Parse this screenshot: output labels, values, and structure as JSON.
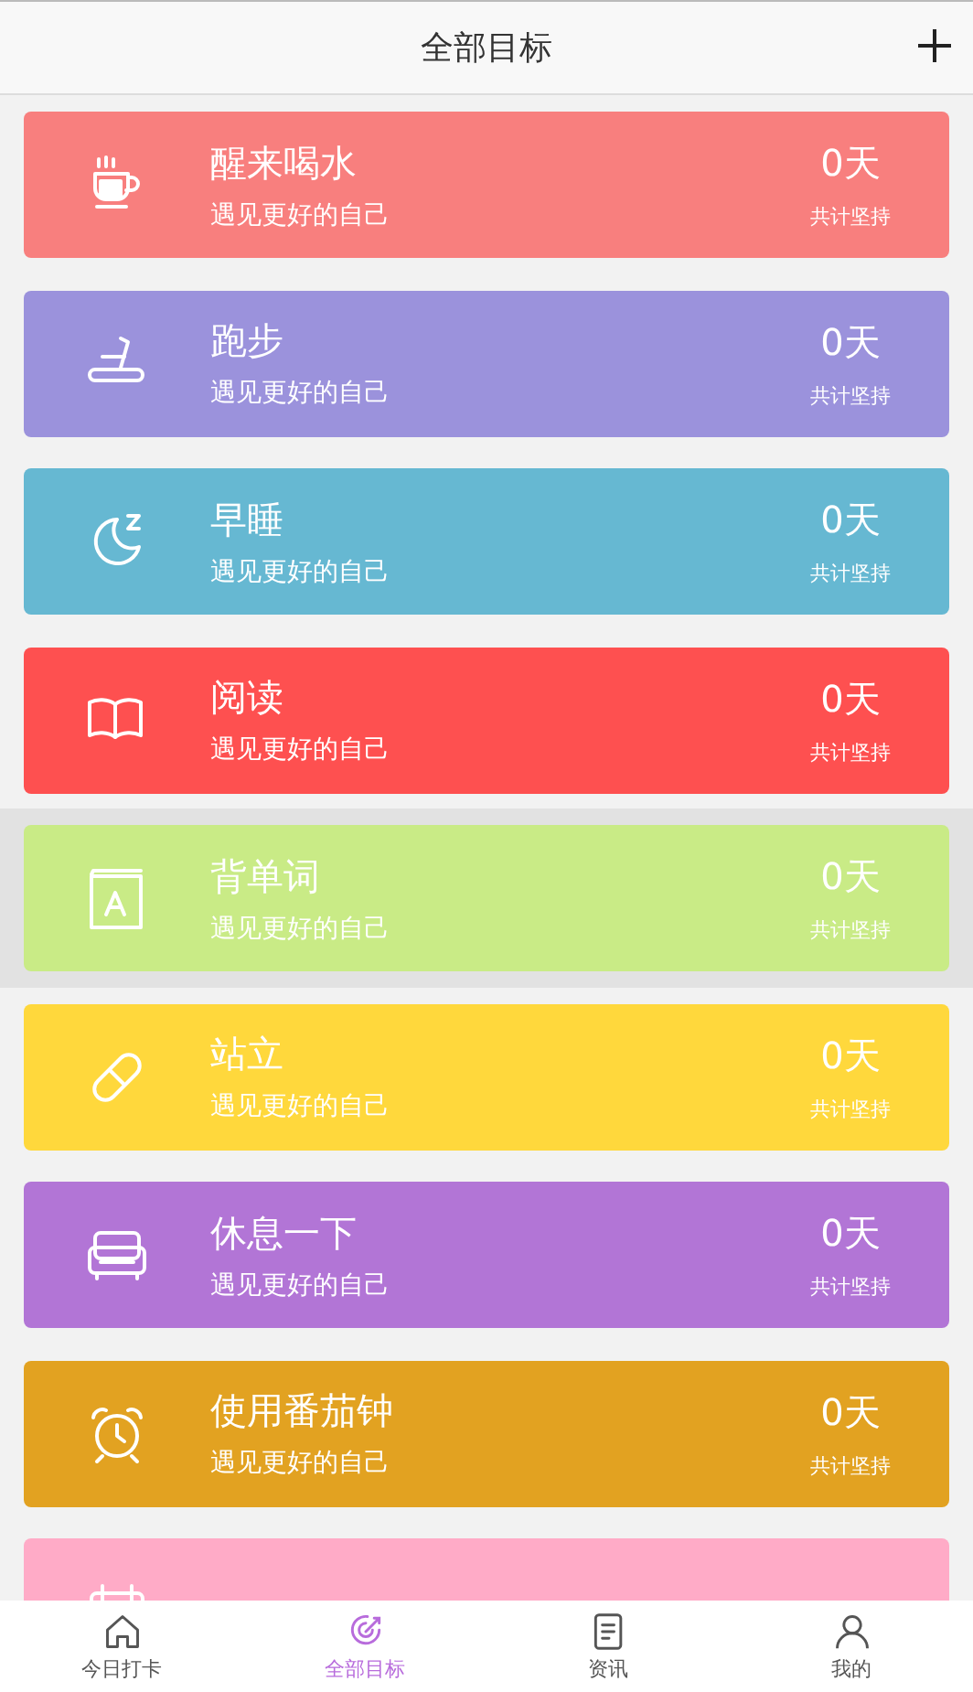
{
  "header": {
    "title": "全部目标"
  },
  "goals": [
    {
      "title": "醒来喝水",
      "subtitle": "遇见更好的自己",
      "days": "0天",
      "days_label": "共计坚持",
      "color": "#f87f7e",
      "selected": false
    },
    {
      "title": "跑步",
      "subtitle": "遇见更好的自己",
      "days": "0天",
      "days_label": "共计坚持",
      "color": "#9b92dc",
      "selected": false
    },
    {
      "title": "早睡",
      "subtitle": "遇见更好的自己",
      "days": "0天",
      "days_label": "共计坚持",
      "color": "#66b8d2",
      "selected": false
    },
    {
      "title": "阅读",
      "subtitle": "遇见更好的自己",
      "days": "0天",
      "days_label": "共计坚持",
      "color": "#fe5050",
      "selected": false
    },
    {
      "title": "背单词",
      "subtitle": "遇见更好的自己",
      "days": "0天",
      "days_label": "共计坚持",
      "color": "#c9eb86",
      "selected": true
    },
    {
      "title": "站立",
      "subtitle": "遇见更好的自己",
      "days": "0天",
      "days_label": "共计坚持",
      "color": "#ffd83c",
      "selected": false
    },
    {
      "title": "休息一下",
      "subtitle": "遇见更好的自己",
      "days": "0天",
      "days_label": "共计坚持",
      "color": "#b275d6",
      "selected": false
    },
    {
      "title": "使用番茄钟",
      "subtitle": "遇见更好的自己",
      "days": "0天",
      "days_label": "共计坚持",
      "color": "#e2a221",
      "selected": false
    },
    {
      "color": "#ffabc7",
      "selected": false
    }
  ],
  "tabs": [
    {
      "label": "今日打卡",
      "selected": false
    },
    {
      "label": "全部目标",
      "selected": true
    },
    {
      "label": "资讯",
      "selected": false
    },
    {
      "label": "我的",
      "selected": false
    }
  ]
}
